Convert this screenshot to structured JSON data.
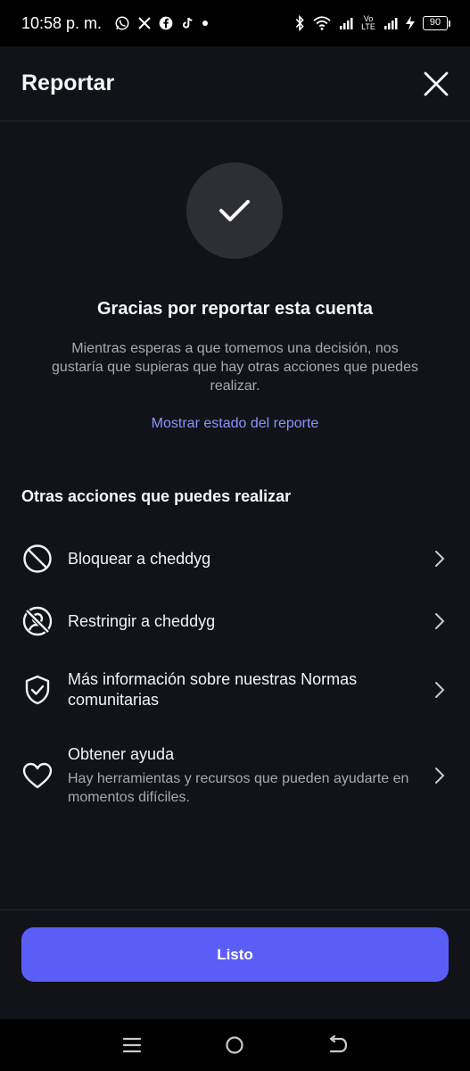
{
  "status_bar": {
    "time": "10:58 p. m.",
    "battery": "90",
    "network": "Vo LTE"
  },
  "header": {
    "title": "Reportar"
  },
  "confirmation": {
    "title": "Gracias por reportar esta cuenta",
    "description": "Mientras esperas a que tomemos una decisión, nos gustaría que supieras que hay otras acciones que puedes realizar.",
    "status_link": "Mostrar estado del reporte"
  },
  "actions": {
    "section_title": "Otras acciones que puedes realizar",
    "items": [
      {
        "label": "Bloquear a cheddyg",
        "icon": "block-icon"
      },
      {
        "label": "Restringir a cheddyg",
        "icon": "restrict-icon"
      },
      {
        "label": "Más información sobre nuestras Normas comunitarias",
        "icon": "shield-check-icon"
      },
      {
        "label": "Obtener ayuda",
        "sublabel": "Hay herramientas y recursos que pueden ayudarte en momentos difíciles.",
        "icon": "heart-icon"
      }
    ]
  },
  "footer": {
    "done_label": "Listo"
  },
  "colors": {
    "background": "#121318",
    "accent": "#5a5ef7",
    "link": "#8c93ff",
    "secondary_text": "#a6a9b1"
  }
}
